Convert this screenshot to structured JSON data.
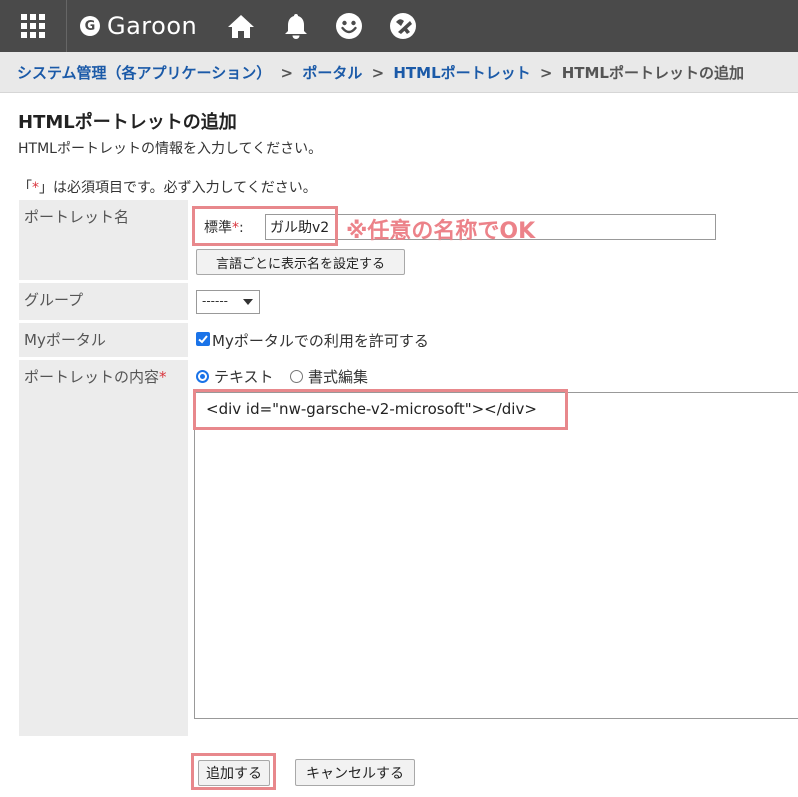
{
  "header": {
    "app_name": "Garoon",
    "logo_letter": "G",
    "icons": [
      "apps-grid-icon",
      "home-icon",
      "bell-icon",
      "smiley-icon",
      "ribbon-icon"
    ]
  },
  "breadcrumb": {
    "items": [
      "システム管理（各アプリケーション）",
      "ポータル",
      "HTMLポートレット"
    ],
    "separator": ">",
    "current": "HTMLポートレットの追加"
  },
  "page": {
    "title": "HTMLポートレットの追加",
    "description": "HTMLポートレットの情報を入力してください。",
    "required_note_before": "「",
    "required_star": "*",
    "required_note_after": "」は必須項目です。必ず入力してください。"
  },
  "form": {
    "portlet_name": {
      "label": "ポートレット名",
      "standard_label": "標準",
      "required_star": "*",
      "colon": ":",
      "value": "ガル助v2",
      "annotation": "※任意の名称でOK",
      "lang_button": "言語ごとに表示名を設定する"
    },
    "group": {
      "label": "グループ",
      "selected": "------"
    },
    "my_portal": {
      "label": "Myポータル",
      "checkbox_label": "Myポータルでの利用を許可する",
      "checked": true
    },
    "content": {
      "label": "ポートレットの内容",
      "required_star": "*",
      "radio_text": "テキスト",
      "radio_rich": "書式編集",
      "selected": "text",
      "value": "<div id=\"nw-garsche-v2-microsoft\"></div>"
    }
  },
  "actions": {
    "add": "追加する",
    "cancel": "キャンセルする"
  },
  "colors": {
    "topbar": "#4a4a4a",
    "link": "#1b5aa8",
    "highlight": "#e8888c",
    "annotation": "#ec8289",
    "checkbox": "#1a73e8"
  }
}
